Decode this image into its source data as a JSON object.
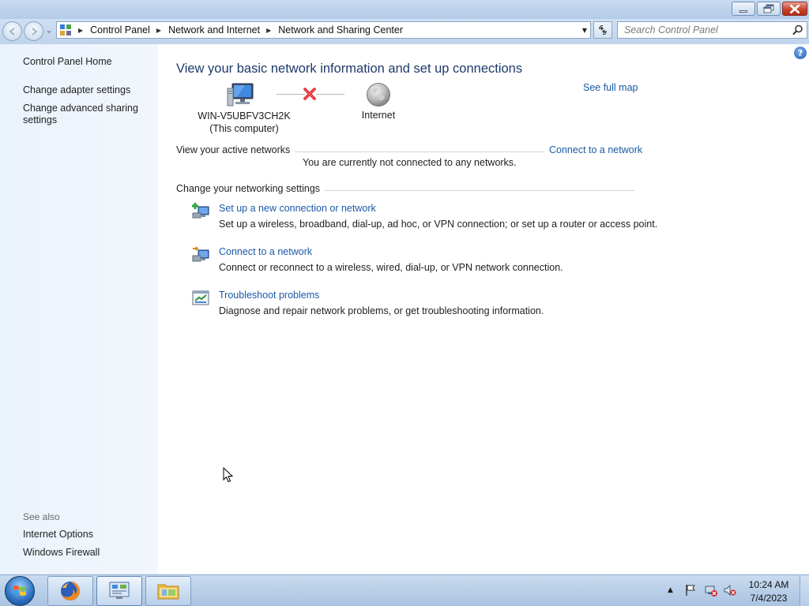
{
  "window": {
    "minimize_icon": "minimize-icon",
    "maximize_icon": "restore-icon",
    "close_icon": "close-icon"
  },
  "nav": {
    "breadcrumb": [
      "Control Panel",
      "Network and Internet",
      "Network and Sharing Center"
    ],
    "search_placeholder": "Search Control Panel"
  },
  "left_pane": {
    "home": "Control Panel Home",
    "links": [
      "Change adapter settings",
      "Change advanced sharing settings"
    ],
    "see_also_label": "See also",
    "see_also": [
      "Internet Options",
      "Windows Firewall"
    ]
  },
  "main": {
    "title": "View your basic network information and set up connections",
    "see_full_map": "See full map",
    "computer_name": "WIN-V5UBFV3CH2K",
    "computer_sub": "(This computer)",
    "internet_label": "Internet",
    "active_networks_label": "View your active networks",
    "connect_link": "Connect to a network",
    "status": "You are currently not connected to any networks.",
    "settings_label": "Change your networking settings",
    "tasks": [
      {
        "title": "Set up a new connection or network",
        "desc": "Set up a wireless, broadband, dial-up, ad hoc, or VPN connection; or set up a router or access point."
      },
      {
        "title": "Connect to a network",
        "desc": "Connect or reconnect to a wireless, wired, dial-up, or VPN network connection."
      },
      {
        "title": "Troubleshoot problems",
        "desc": "Diagnose and repair network problems, or get troubleshooting information."
      }
    ]
  },
  "taskbar": {
    "time": "10:24 AM",
    "date": "7/4/2023"
  },
  "colors": {
    "link": "#1a5aa8",
    "title": "#1e3a6b",
    "left_pane_bg": "#eaf2fb"
  }
}
